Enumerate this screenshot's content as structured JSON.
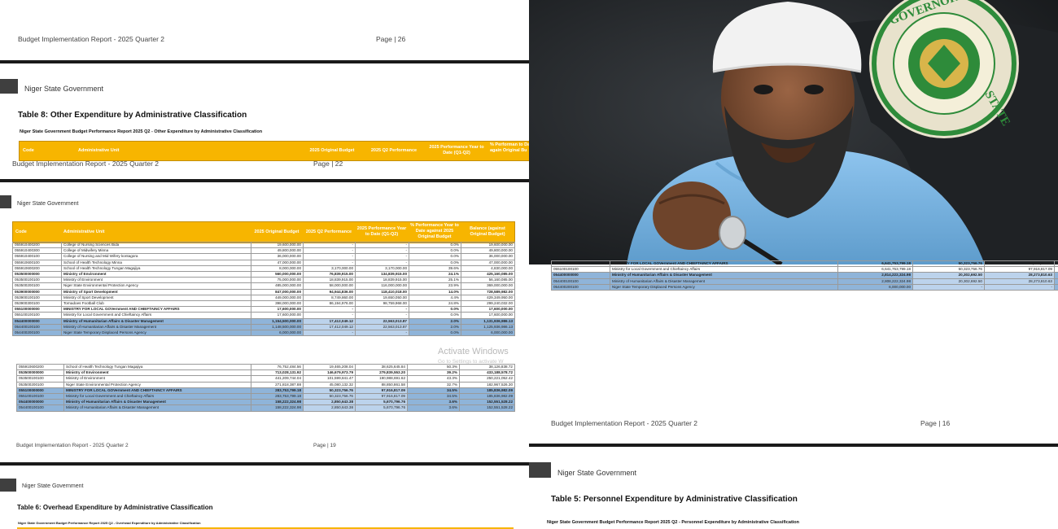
{
  "page_a": {
    "footer_left": "Budget Implementation Report - 2025 Quarter 2",
    "footer_page": "Page | 26",
    "gov_name": "Niger State Government",
    "table_title": "Table 8: Other Expenditure by Administrative Classification",
    "table_sub": "Niger State Government Budget Performance Report 2025 Q2 - Other Expenditure by Administrative Classification",
    "headers": [
      "Code",
      "Administrative Unit",
      "2025 Original Budget",
      "2025 Q2 Performance",
      "2025 Performance Year to Date (Q1-Q2)",
      "% Performan to Date again Original Bu"
    ]
  },
  "page_b": {
    "footer_left": "Budget Implementation Report - 2025 Quarter 2",
    "footer_page": "Page | 22",
    "gov_name": "Niger State Government",
    "headers": [
      "Code",
      "Administrative Unit",
      "2025 Original Budget",
      "2025 Q2 Performance",
      "2025 Performance Year to Date (Q1-Q2)",
      "% Performance Year to Date against 2025 Original Budget",
      "Balance (against Original Budget)"
    ],
    "rows": [
      {
        "c": "055910400200",
        "u": "College of Nursing Sciences Bida",
        "b": "19,600,000.00",
        "q": "-",
        "y": "-",
        "p": "0.0%",
        "bal": "19,600,000.00"
      },
      {
        "c": "055910400300",
        "u": "College of Midwifery Minna",
        "b": "49,800,000.00",
        "q": "-",
        "y": "-",
        "p": "0.0%",
        "bal": "49,800,000.00"
      },
      {
        "c": "055910400100",
        "u": "College of Nursing and Mid Wifery kontagora",
        "b": "36,000,000.00",
        "q": "-",
        "y": "-",
        "p": "0.0%",
        "bal": "36,000,000.00"
      },
      {
        "c": "055910600100",
        "u": "School of Health Technology Minna",
        "b": "47,000,000.00",
        "q": "-",
        "y": "-",
        "p": "0.0%",
        "bal": "47,000,000.00"
      },
      {
        "c": "055910600200",
        "u": "School of Health Technology Tungan Magajiya",
        "b": "8,000,000.00",
        "q": "3,170,000.00",
        "y": "3,170,000.00",
        "p": "39.6%",
        "bal": "4,830,000.00"
      },
      {
        "c": "053500000000",
        "u": "Ministry of Environment",
        "b": "560,000,000.00",
        "q": "76,839,915.00",
        "y": "134,839,915.00",
        "p": "24.1%",
        "bal": "425,160,085.00",
        "bold": true
      },
      {
        "c": "053500100100",
        "u": "Ministry of Environment",
        "b": "75,000,000.00",
        "q": "18,839,915.00",
        "y": "18,839,915.00",
        "p": "25.1%",
        "bal": "56,160,085.00"
      },
      {
        "c": "053500200100",
        "u": "Niger State Environmental Protection Agency",
        "b": "485,000,000.00",
        "q": "58,000,000.00",
        "y": "116,000,000.00",
        "p": "23.9%",
        "bal": "369,000,000.00"
      },
      {
        "c": "053900000000",
        "u": "Ministry of Sport Development",
        "b": "847,000,000.00",
        "q": "94,944,836.00",
        "y": "118,410,018.00",
        "p": "14.0%",
        "bal": "728,589,982.00",
        "bold": true
      },
      {
        "c": "053900100100",
        "u": "Ministry of Sport Development",
        "b": "449,000,000.00",
        "q": "8,749,860.00",
        "y": "19,650,050.00",
        "p": "4.4%",
        "bal": "429,349,950.00"
      },
      {
        "c": "053900300100",
        "u": "Tornadoes Football Club",
        "b": "398,000,000.00",
        "q": "86,194,976.00",
        "y": "98,759,968.00",
        "p": "24.8%",
        "bal": "299,240,032.00"
      },
      {
        "c": "055100000000",
        "u": "MINISTRY FOR LOCAL GOVernment AND CHIEFTAINCY AFFAIRS",
        "b": "17,600,000.00",
        "q": "-",
        "y": "-",
        "p": "0.0%",
        "bal": "17,600,000.00",
        "bold": true
      },
      {
        "c": "055100100100",
        "u": "Ministry for Local Government and Chieftaincy Affairs",
        "b": "17,600,000.00",
        "q": "-",
        "y": "-",
        "p": "0.0%",
        "bal": "17,600,000.00"
      },
      {
        "c": "054400000000",
        "u": "Ministry of Humanitarian Affairs & Disaster Management",
        "b": "1,154,500,000.00",
        "q": "17,412,049.12",
        "y": "22,563,013.87",
        "p": "2.0%",
        "bal": "1,131,936,986.13",
        "bold": true,
        "hl": true
      },
      {
        "c": "054400100100",
        "u": "Ministry of Humanitarian Affairs & Disaster Management",
        "b": "1,148,500,000.00",
        "q": "17,412,049.12",
        "y": "22,563,013.87",
        "p": "2.0%",
        "bal": "1,125,936,986.13",
        "hl": true
      },
      {
        "c": "054400200100",
        "u": "Niger State Temporary Displaced Persons Agency",
        "b": "6,000,000.00",
        "q": "-",
        "y": "-",
        "p": "0.0%",
        "bal": "6,000,000.00",
        "hl": true
      }
    ],
    "watermark": "Activate Windows",
    "watermark_sub": "Go to Settings to activate W"
  },
  "page_c": {
    "rows": [
      {
        "c": "055910600200",
        "u": "School of Health Technology Tungan Magajiya",
        "b": "76,752,484.56",
        "q": "19,465,208.04",
        "y": "38,625,645.84",
        "p": "50.3%",
        "bal": "38,126,838.72"
      },
      {
        "c": "053500000000",
        "u": "Ministry of Environment",
        "b": "713,028,131.92",
        "q": "146,679,973.79",
        "y": "279,839,553.20",
        "p": "39.2%",
        "bal": "433,188,578.72",
        "bold": true
      },
      {
        "c": "053500100100",
        "u": "Ministry of Environment",
        "b": "441,209,744.04",
        "q": "101,599,841.47",
        "y": "190,988,691.62",
        "p": "43.3%",
        "bal": "250,221,052.42"
      },
      {
        "c": "053500200100",
        "u": "Niger State Environmental Protection Agency",
        "b": "271,818,387.88",
        "q": "45,080,132.32",
        "y": "88,850,861.58",
        "p": "32.7%",
        "bal": "182,967,526.30"
      },
      {
        "c": "055100000000",
        "u": "MINISTRY FOR LOCAL GOVernment AND CHIEFTAINCY AFFAIRS",
        "b": "283,753,799.18",
        "q": "50,323,756.76",
        "y": "97,916,817.09",
        "p": "34.5%",
        "bal": "185,836,982.09",
        "bold": true,
        "hl": true
      },
      {
        "c": "055100100100",
        "u": "Ministry for Local Government and Chieftaincy Affairs",
        "b": "283,753,799.18",
        "q": "50,323,756.76",
        "y": "97,916,817.09",
        "p": "34.5%",
        "bal": "185,836,982.09",
        "hl": true
      },
      {
        "c": "054400000000",
        "u": "Ministry of Humanitarian Affairs & Disaster Management",
        "b": "158,222,324.98",
        "q": "2,850,643.38",
        "y": "5,670,796.76",
        "p": "3.6%",
        "bal": "152,551,528.22",
        "bold": true,
        "hl": true
      },
      {
        "c": "054400100100",
        "u": "Ministry of Humanitarian Affairs & Disaster Management",
        "b": "158,222,324.98",
        "q": "2,850,643.38",
        "y": "5,670,796.76",
        "p": "3.6%",
        "bal": "152,551,528.22",
        "hl": true
      }
    ],
    "footer_left": "Budget Implementation Report - 2025 Quarter 2",
    "footer_page": "Page | 19"
  },
  "page_d": {
    "gov_name": "Niger State Government",
    "table_title": "Table 6: Overhead Expenditure by Administrative Classification",
    "table_sub": "Niger State Government Budget Performance Report 2025 Q2 - Overhead Expenditure by Administrative Classification"
  },
  "page_e": {
    "rows": [
      {
        "c": "055100000000",
        "u": "MINISTRY FOR LOCAL GOVernment AND CHIEFTAINCY AFFAIRS",
        "b": "6,641,753,799.18",
        "q": "50,323,756.76",
        "y": "97,916,817.09",
        "bold": true
      },
      {
        "c": "055100100100",
        "u": "Ministry for Local Government and Chieftaincy Affairs",
        "b": "6,641,753,799.18",
        "q": "50,323,756.76",
        "y": "97,916,817.09"
      },
      {
        "c": "054400000000",
        "u": "Ministry of Humanitarian Affairs & Disaster Management",
        "b": "2,814,222,324.98",
        "q": "20,302,692.50",
        "y": "28,273,810.63",
        "bold": true,
        "hl": true
      },
      {
        "c": "054400100100",
        "u": "Ministry of Humanitarian Affairs & Disaster Management",
        "b": "2,808,222,324.98",
        "q": "20,302,692.50",
        "y": "28,273,810.63",
        "hl": true
      },
      {
        "c": "054400200100",
        "u": "Niger State Temporary Displaced Persons Agency",
        "b": "6,000,000.00",
        "q": "-",
        "y": "-",
        "hl": true
      }
    ],
    "footer_left": "Budget Implementation Report - 2025 Quarter 2",
    "footer_page": "Page | 16",
    "gov_name": "Niger State Government",
    "table_title": "Table 5: Personnel Expenditure by Administrative Classification",
    "table_sub": "Niger State Government Budget Performance Report 2025 Q2 - Personnel Expenditure by Administrative Classification"
  },
  "photo": {
    "seal_text": "SEAL OF THE GOVERNOR NIGER STATE",
    "colors": {
      "wall": "#1c1f22",
      "shirt": "#7fb8e6",
      "cap": "#f2f2f2",
      "skin": "#8a5a3c",
      "seal_green": "#2e8b3a",
      "seal_gold": "#d8b54a"
    }
  }
}
